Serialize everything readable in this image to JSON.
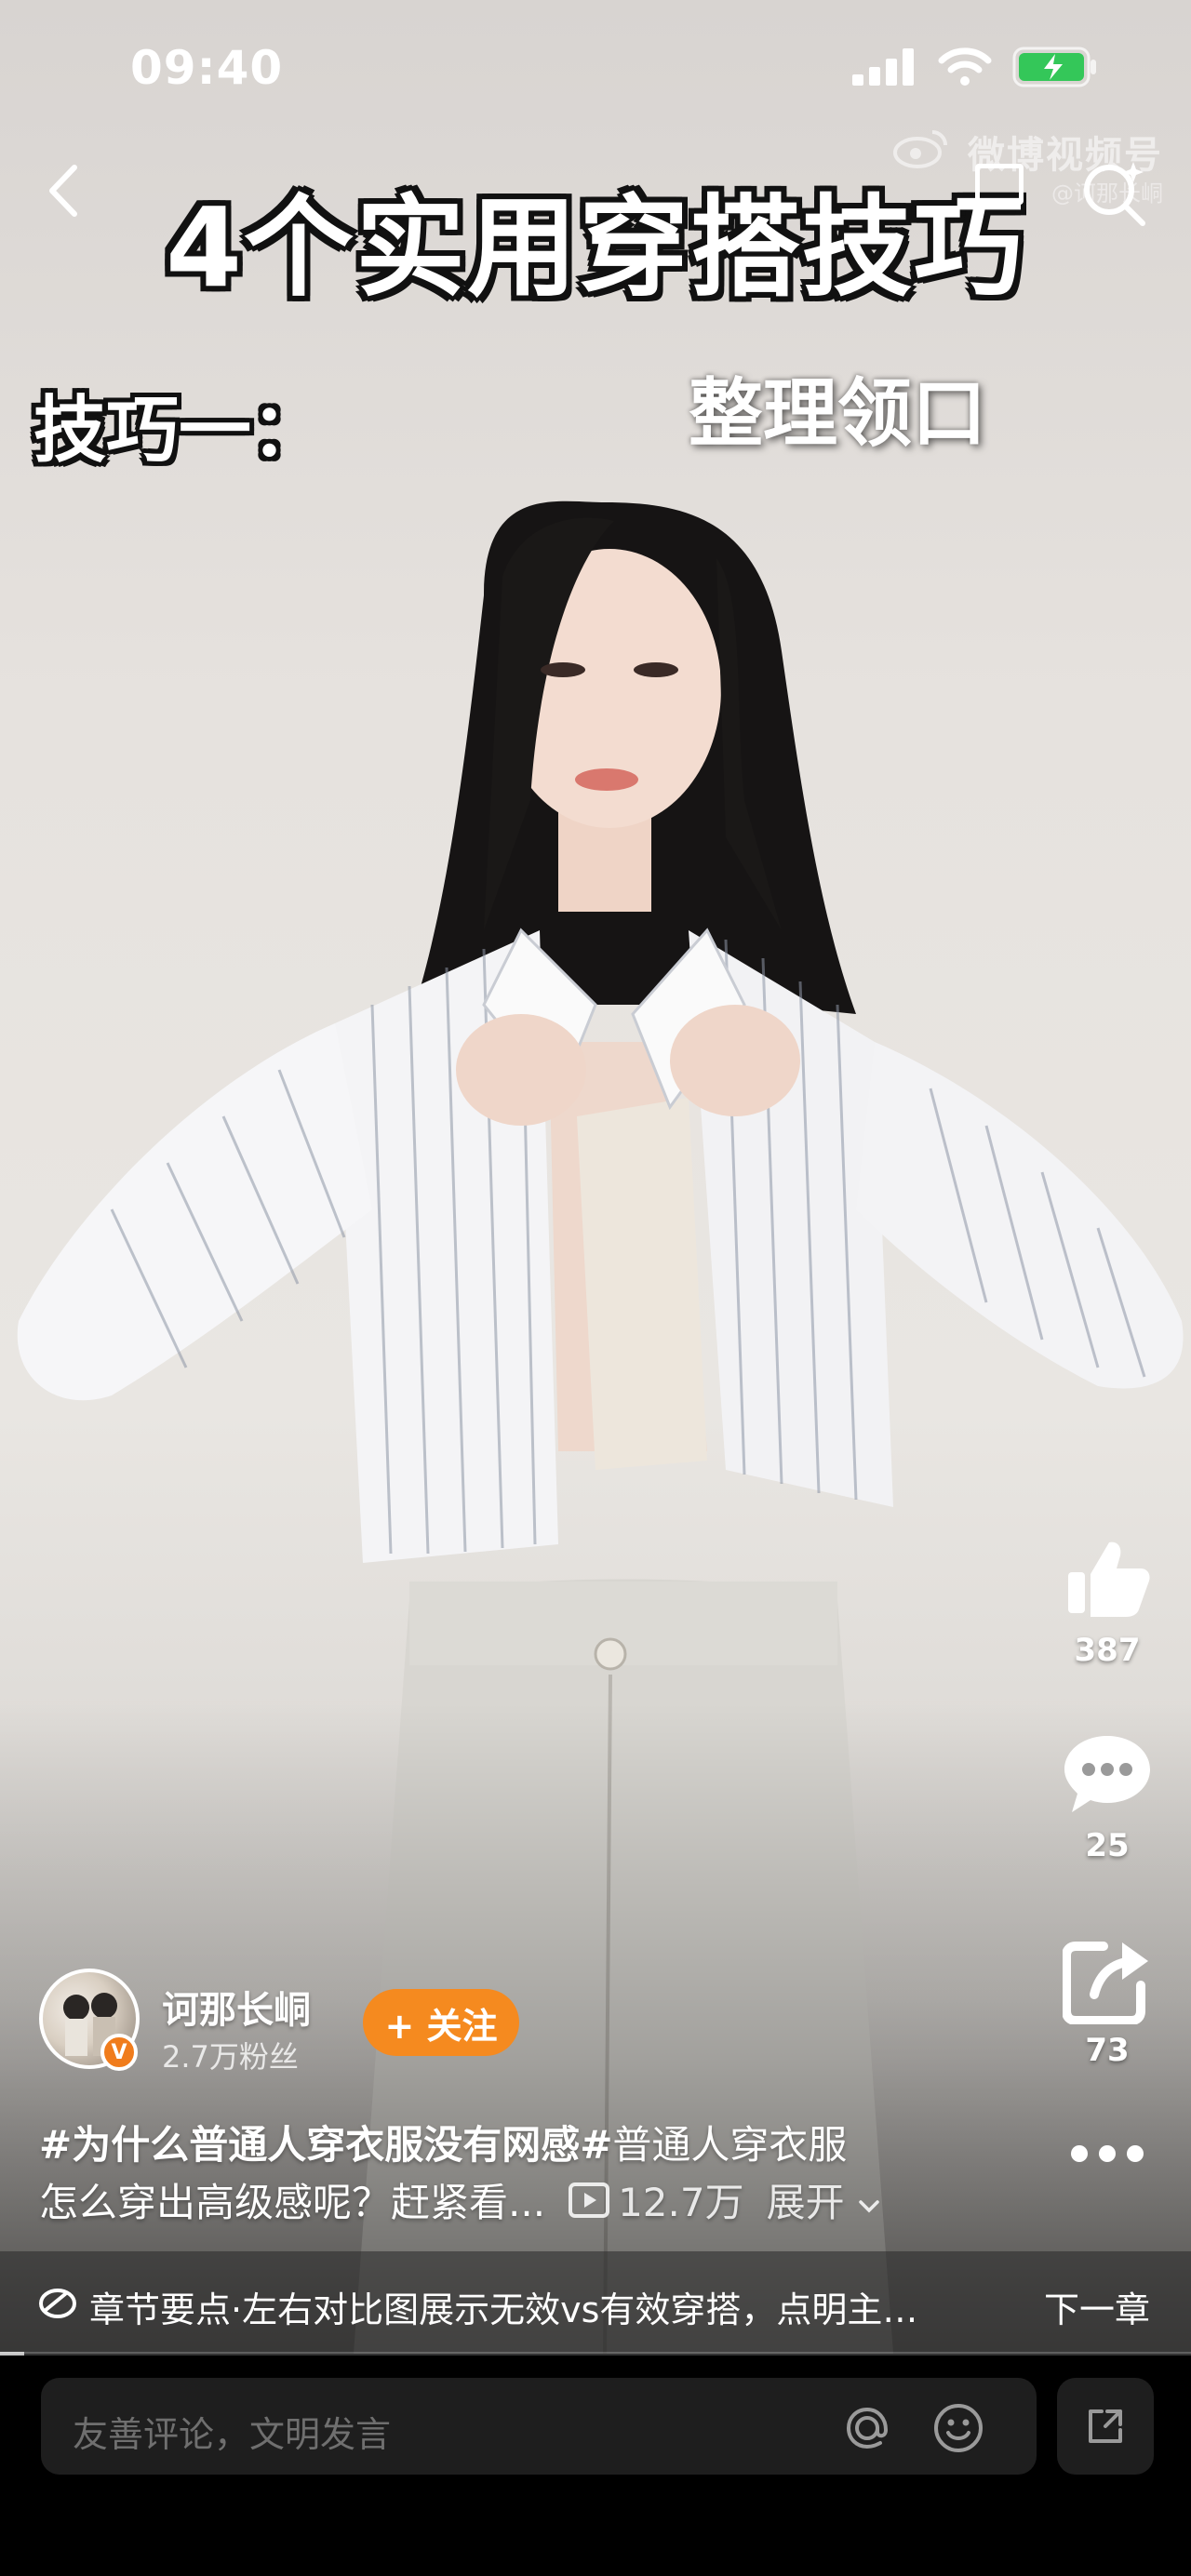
{
  "status_bar": {
    "time": "09:40"
  },
  "watermark": {
    "brand": "微博视频号",
    "account": "@诃那长峒"
  },
  "video": {
    "title_caption": "4个实用穿搭技巧",
    "tip_caption": "技巧一：",
    "step_caption": "整理领口",
    "progress": 0.02
  },
  "actions": {
    "like_count": "387",
    "comment_count": "25",
    "share_count": "73"
  },
  "author": {
    "name": "诃那长峒",
    "fans": "2.7万粉丝",
    "follow_label": "+ 关注"
  },
  "description": {
    "hashtags": "#为什么普通人穿衣服没有网感#",
    "line1_rest": "普通人穿衣服",
    "line2": "怎么穿出高级感呢？赶紧看...",
    "views": "12.7万",
    "expand_label": "展开"
  },
  "chapter": {
    "text": "章节要点·左右对比图展示无效vs有效穿搭，点明主…",
    "next_label": "下一章"
  },
  "comment_bar": {
    "placeholder": "友善评论，文明发言"
  },
  "colors": {
    "follow_button": "#f58a1f",
    "verified_badge": "#f07c1c",
    "battery": "#34c759"
  }
}
